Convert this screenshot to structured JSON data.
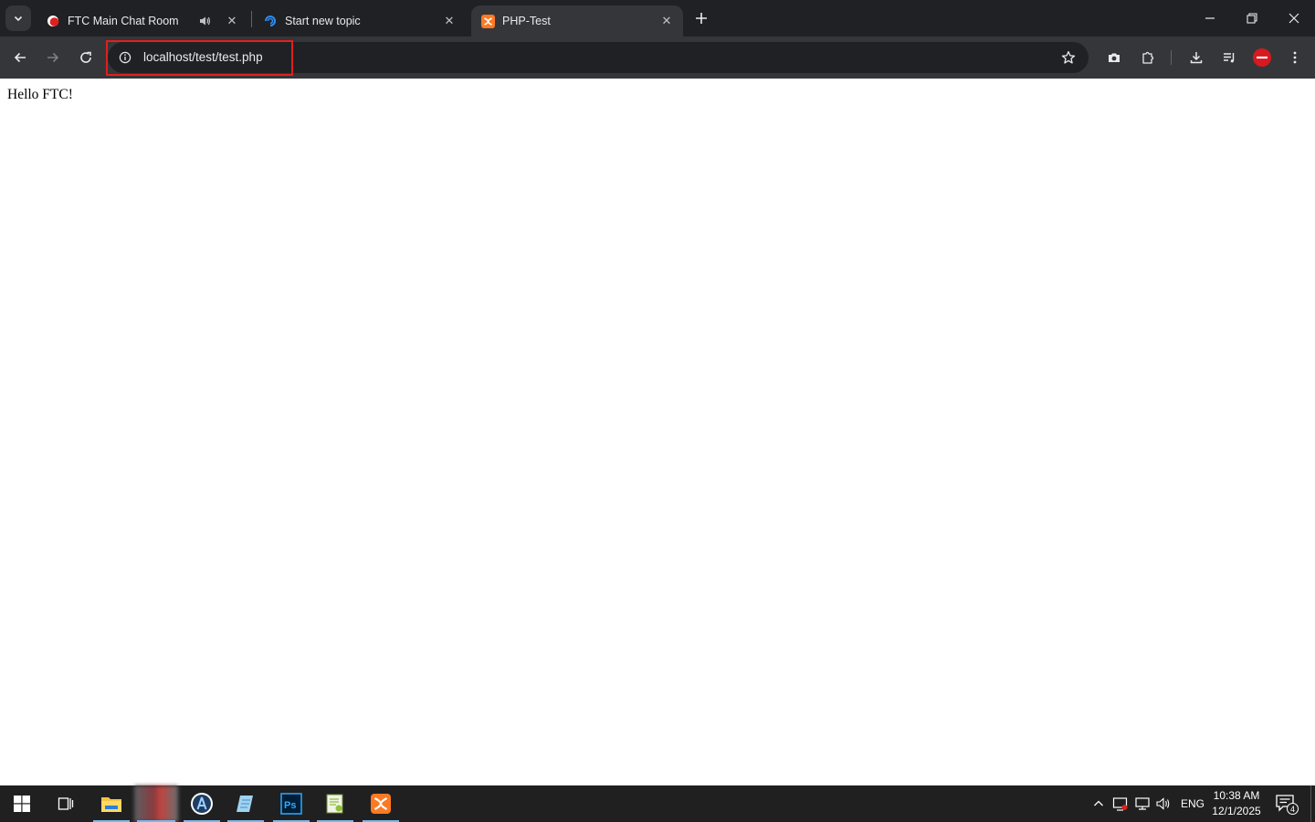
{
  "browser": {
    "tabs": [
      {
        "title": "FTC Main Chat Room",
        "icon": "chat-room-favicon-icon",
        "audio_icon": "speaker-icon",
        "active": false
      },
      {
        "title": "Start new topic",
        "icon": "forum-favicon-icon",
        "active": false
      },
      {
        "title": "PHP-Test",
        "icon": "xampp-favicon-icon",
        "active": true
      }
    ],
    "address_bar": {
      "url": "localhost/test/test.php",
      "info_icon": "info-icon"
    },
    "toolbar_icons": [
      "back-icon",
      "forward-icon",
      "reload-icon",
      "star-icon",
      "camera-icon",
      "extensions-icon",
      "download-icon",
      "media-playlist-icon",
      "profile-avatar-icon",
      "menu-dots-icon"
    ],
    "highlight_color": "#e0201c"
  },
  "page": {
    "text": "Hello FTC!"
  },
  "taskbar": {
    "apps": [
      "windows-start-icon",
      "task-view-icon",
      "file-explorer-icon",
      "blurred-app-icon",
      "android-studio-icon",
      "notepad-icon",
      "photoshop-icon",
      "notepad-plus-plus-icon",
      "xampp-icon"
    ],
    "language": "ENG",
    "time": "10:38 AM",
    "date": "12/1/2025",
    "notification_count": "4"
  }
}
